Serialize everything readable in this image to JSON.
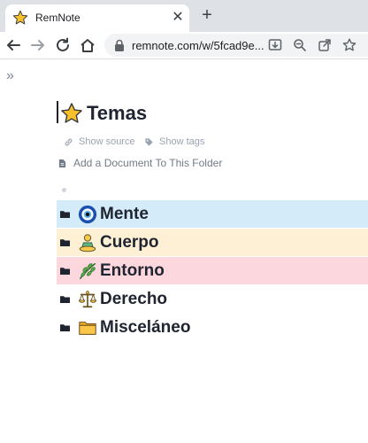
{
  "browser": {
    "tab_title": "RemNote",
    "tab_close": "✕",
    "new_tab": "+",
    "url": "remnote.com/w/5fcad9e..."
  },
  "document": {
    "title": "Temas",
    "show_source": "Show source",
    "show_tags": "Show tags",
    "add_document": "Add a Document To This Folder"
  },
  "rows": [
    {
      "label": "Mente",
      "color": "#d4ecfa",
      "icon": "nazar-amulet-icon"
    },
    {
      "label": "Cuerpo",
      "color": "#fdf0d5",
      "icon": "person-in-lotus-position-icon"
    },
    {
      "label": "Entorno",
      "color": "#fdd7de",
      "icon": "herb-icon"
    },
    {
      "label": "Derecho",
      "color": "#ffffff",
      "icon": "balance-scale-icon"
    },
    {
      "label": "Misceláneo",
      "color": "#ffffff",
      "icon": "file-folder-icon"
    }
  ]
}
